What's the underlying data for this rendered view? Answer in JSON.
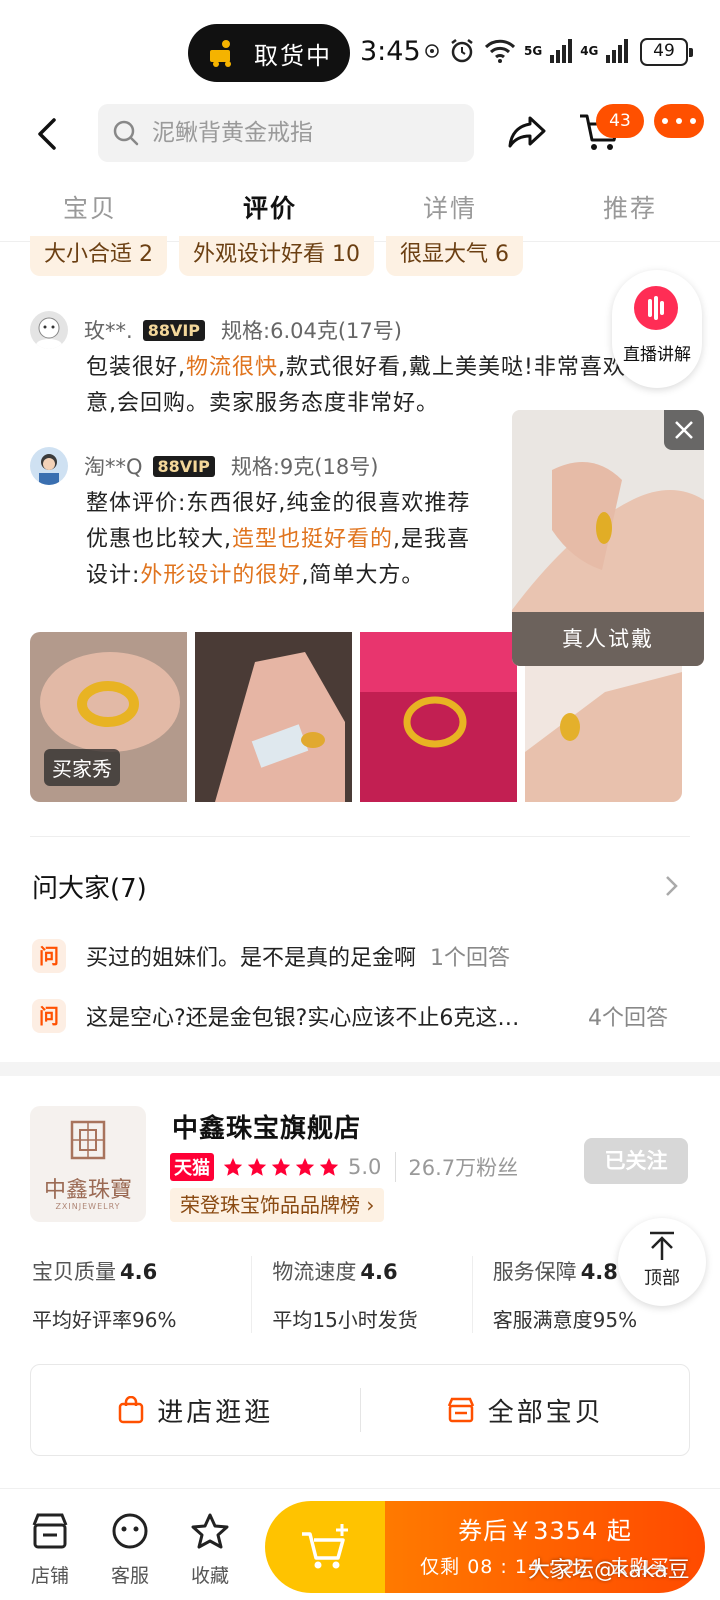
{
  "status_bar": {
    "pickup_label": "取货中",
    "time": "3:45",
    "net1": "5G",
    "net2": "4G",
    "battery": "49"
  },
  "nav": {
    "search_placeholder": "泥鳅背黄金戒指",
    "cart_count": "43"
  },
  "tabs": [
    "宝贝",
    "评价",
    "详情",
    "推荐"
  ],
  "active_tab": "评价",
  "review_tags": [
    "大小合适 2",
    "外观设计好看 10",
    "很显大气 6"
  ],
  "reviews": [
    {
      "name": "玫**.",
      "badge": "88VIP",
      "spec": "规格:6.04克(17号)",
      "text_before": "包装很好,",
      "highlight1": "物流很快",
      "text_after": ",款式很好看,戴上美美哒!非常喜欢,满意,会回购。卖家服务态度非常好。"
    },
    {
      "name": "淘**Q",
      "badge": "88VIP",
      "spec": "规格:9克(18号)",
      "line1": "整体评价:东西很好,纯金的很喜欢推荐",
      "line2_a": "优惠也比较大,",
      "line2_hl": "造型也挺好看的",
      "line2_b": ",是我喜",
      "line3_a": "设计:",
      "line3_hl": "外形设计的很好",
      "line3_b": ",简单大方。"
    }
  ],
  "buyer_show_label": "买家秀",
  "live": {
    "label": "直播讲解",
    "tryon_label": "真人试戴"
  },
  "qa": {
    "title": "问大家(7)",
    "badge": "问",
    "items": [
      {
        "question": "买过的姐妹们。是不是真的足金啊",
        "answers": "1个回答"
      },
      {
        "question": "这是空心?还是金包银?实心应该不止6克这…",
        "answers": "4个回答"
      }
    ]
  },
  "store": {
    "logo_text": "中鑫珠寶",
    "logo_sub": "ZXINJEWELRY",
    "name": "中鑫珠宝旗舰店",
    "tmall": "天猫",
    "rating": "5.0",
    "fans": "26.7万粉丝",
    "rank": "荣登珠宝饰品品牌榜",
    "follow_label": "已关注",
    "metrics": [
      {
        "label": "宝贝质量",
        "value": "4.6",
        "sub": "平均好评率96%"
      },
      {
        "label": "物流速度",
        "value": "4.6",
        "sub": "平均15小时发货"
      },
      {
        "label": "服务保障",
        "value": "4.8",
        "sub": "客服满意度95%"
      }
    ],
    "visit_label": "进店逛逛",
    "all_items_label": "全部宝贝"
  },
  "top_label": "顶部",
  "bottom": {
    "shop": "店铺",
    "service": "客服",
    "fav": "收藏",
    "price_line": "券后￥3354 起",
    "countdown": "仅剩 08 : 14 : 22 · 去购买"
  },
  "watermark": "大家坛@kaka豆",
  "colors": {
    "accent": "#ff5000",
    "highlight": "#e0741e",
    "tmall": "#ff0036"
  }
}
